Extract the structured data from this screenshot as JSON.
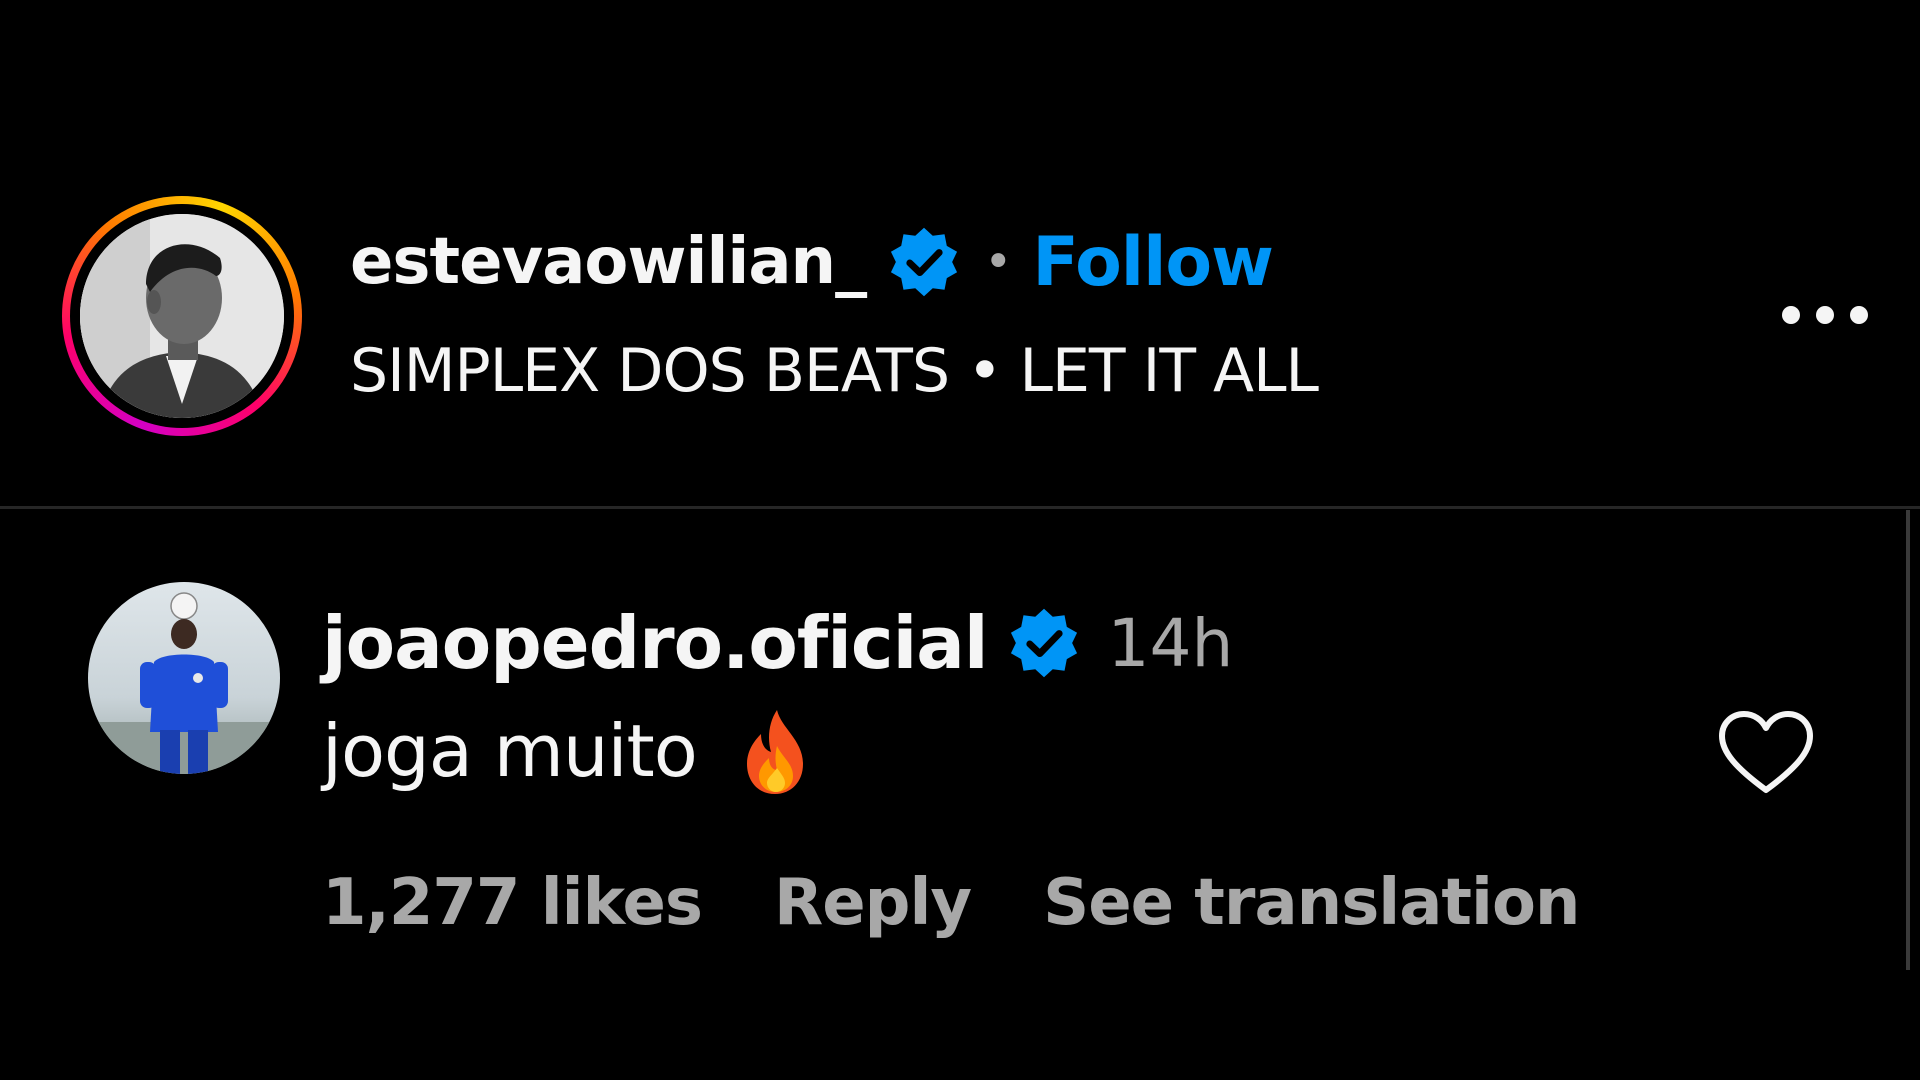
{
  "post": {
    "author": {
      "username": "estevaowilian_",
      "verified": true,
      "avatar": "profile-photo-grayscale"
    },
    "separator": "•",
    "follow_label": "Follow",
    "music": "SIMPLEX DOS BEATS • LET IT ALL",
    "more_options_icon": "more-horizontal-icon"
  },
  "comment": {
    "username": "joaopedro.oficial",
    "verified": true,
    "avatar": "profile-photo-blue-kit",
    "time": "14h",
    "text": "joga muito",
    "emoji": "fire-emoji",
    "likes": "1,277 likes",
    "reply_label": "Reply",
    "translate_label": "See translation",
    "like_icon": "heart-outline-icon"
  },
  "colors": {
    "background": "#000000",
    "text_primary": "#f5f5f5",
    "text_secondary": "#a8a8a8",
    "accent": "#0095f6",
    "verified_badge": "#0095f6",
    "divider": "#262626"
  }
}
